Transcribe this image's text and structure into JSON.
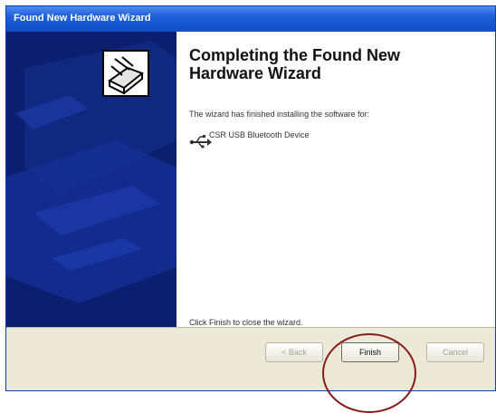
{
  "window": {
    "title": "Found New Hardware Wizard"
  },
  "content": {
    "heading_line1": "Completing the Found New",
    "heading_line2": "Hardware Wizard",
    "description": "The wizard has finished installing the software for:",
    "device_name": "CSR USB Bluetooth Device",
    "device_icon": "usb-icon",
    "footer_text": "Click Finish to close the wizard."
  },
  "buttons": {
    "back_label": "< Back",
    "finish_label": "Finish",
    "cancel_label": "Cancel"
  },
  "colors": {
    "titlebar": "#0f4fc7",
    "banner": "#0c1f6e",
    "highlight_circle": "#8b1a1a",
    "button_bar": "#ece9d8"
  }
}
